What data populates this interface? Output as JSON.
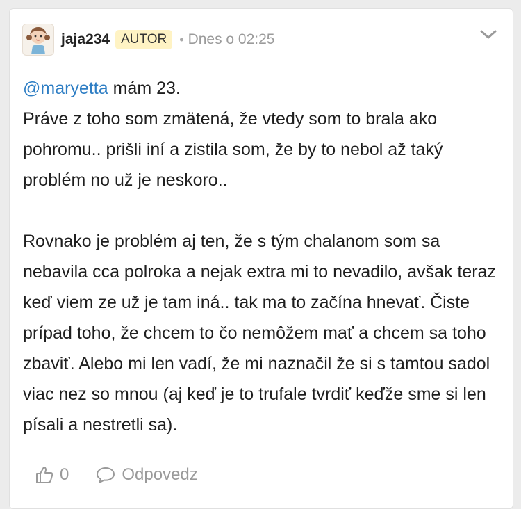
{
  "post": {
    "author": {
      "username": "jaja234",
      "avatar_icon": "girl-avatar-icon",
      "badge": "AUTOR"
    },
    "separator": "•",
    "timestamp": "Dnes o 02:25",
    "menu_icon": "chevron-down-icon",
    "body": {
      "mention": "@maryetta",
      "line1_rest": " mám 23.",
      "paragraph1": "Práve z toho som zmätená, že vtedy som to brala ako pohromu.. prišli iní a zistila som, že by to nebol až taký problém no už je neskoro..",
      "paragraph2": "Rovnako je problém aj ten, že s tým chalanom som sa nebavila cca polroka a nejak extra mi to nevadilo, avšak teraz keď viem ze už je tam iná.. tak ma to začína hnevať. Čiste prípad toho, že chcem to čo nemôžem mať a chcem sa toho zbaviť. Alebo mi len vadí, že mi naznačil že si s tamtou sadol viac nez so mnou (aj keď je to trufale tvrdiť keďže sme si len písali a nestretli sa)."
    },
    "actions": {
      "like_icon": "thumbs-up-icon",
      "like_count": "0",
      "reply_icon": "speech-bubble-icon",
      "reply_label": "Odpovedz"
    },
    "colors": {
      "mention": "#2e7ec4",
      "badge_bg": "#fff3c4",
      "muted": "#9a9a9a"
    }
  }
}
